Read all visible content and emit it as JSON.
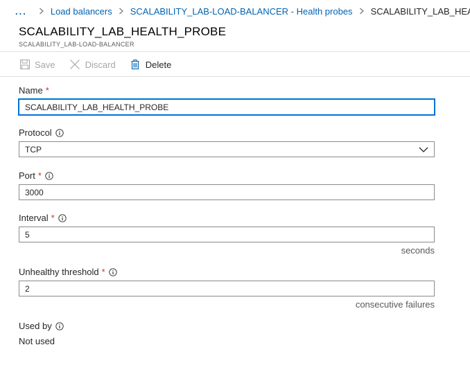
{
  "breadcrumb": {
    "ellipsis": "...",
    "items": [
      {
        "label": "Load balancers"
      },
      {
        "label": "SCALABILITY_LAB-LOAD-BALANCER - Health probes"
      }
    ],
    "current": "SCALABILITY_LAB_HEALTH_PROBE"
  },
  "header": {
    "title": "SCALABILITY_LAB_HEALTH_PROBE",
    "subtitle": "SCALABILITY_LAB-LOAD-BALANCER"
  },
  "toolbar": {
    "save_label": "Save",
    "discard_label": "Discard",
    "delete_label": "Delete"
  },
  "form": {
    "name": {
      "label": "Name",
      "required_mark": "*",
      "value": "SCALABILITY_LAB_HEALTH_PROBE"
    },
    "protocol": {
      "label": "Protocol",
      "value": "TCP"
    },
    "port": {
      "label": "Port",
      "required_mark": "*",
      "value": "3000"
    },
    "interval": {
      "label": "Interval",
      "required_mark": "*",
      "value": "5",
      "unit": "seconds"
    },
    "unhealthy_threshold": {
      "label": "Unhealthy threshold",
      "required_mark": "*",
      "value": "2",
      "unit": "consecutive failures"
    },
    "used_by": {
      "label": "Used by",
      "value": "Not used"
    }
  },
  "colors": {
    "link": "#0063b1",
    "required": "#c0392b",
    "focus_border": "#0078d4",
    "disabled_text": "#a6a6a6"
  },
  "icons": {
    "save": "save-icon",
    "discard": "close-icon",
    "delete": "trash-icon",
    "info": "info-icon",
    "dropdown": "chevron-down-icon",
    "separator": "chevron-right-icon"
  }
}
